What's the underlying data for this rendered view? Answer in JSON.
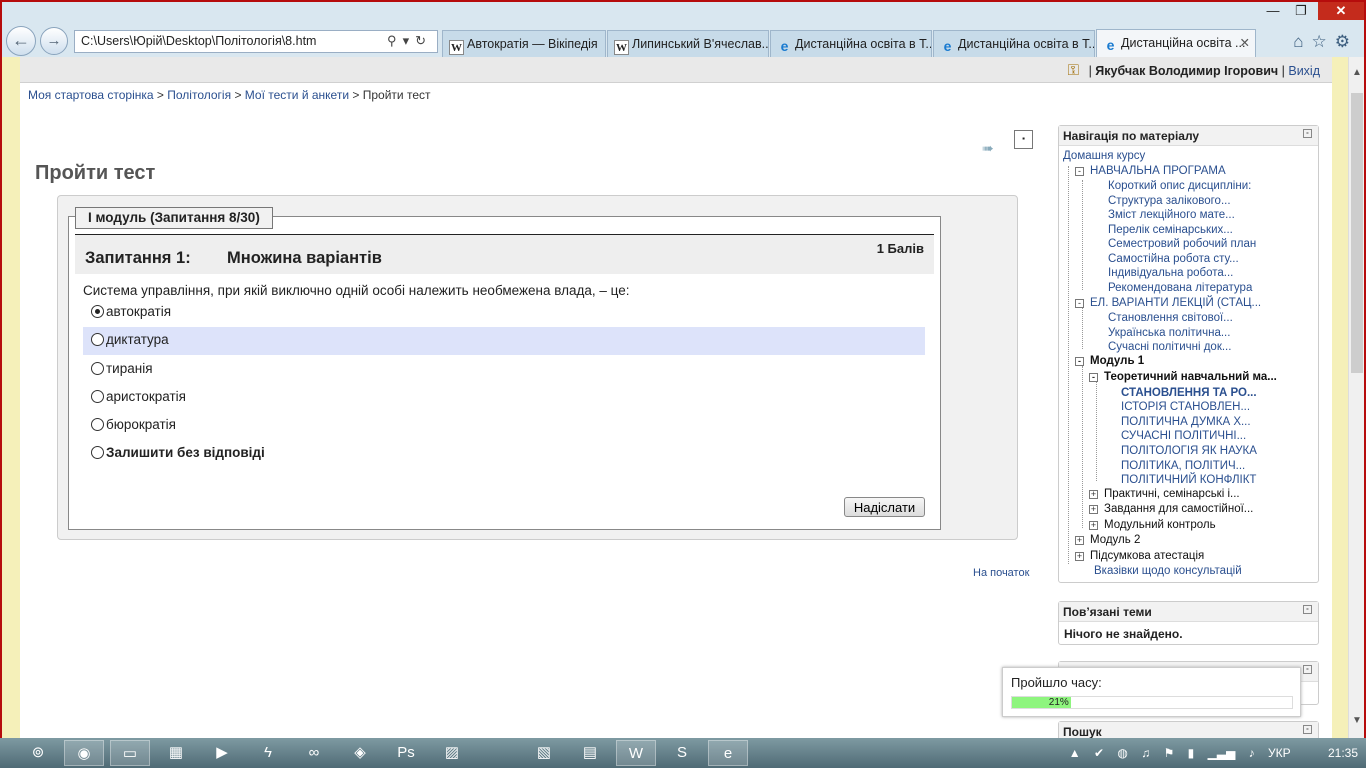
{
  "browser": {
    "address": "C:\\Users\\Юрій\\Desktop\\Політологія\\8.htm",
    "tabs": [
      {
        "label": "Автократія — Вікіпедія",
        "icon": "W"
      },
      {
        "label": "Липинський В'ячеслав...",
        "icon": "W"
      },
      {
        "label": "Дистанційна освіта в Т...",
        "icon": "e"
      },
      {
        "label": "Дистанційна освіта в Т...",
        "icon": "e"
      },
      {
        "label": "Дистанційна освіта ...",
        "icon": "e"
      }
    ],
    "window_buttons": {
      "minimize": "—",
      "maximize": "❐",
      "close": "✕"
    },
    "tab_close": "✕"
  },
  "header": {
    "user_name": "Якубчак Володимир Ігорович",
    "separator": "|",
    "logout": "Вихід"
  },
  "breadcrumb": {
    "items": [
      "Моя стартова сторінка",
      "Політологія",
      "Мої тести й анкети",
      "Пройти тест"
    ],
    "sep": ">"
  },
  "page": {
    "title": "Пройти тест",
    "to_top": "На початок"
  },
  "quiz": {
    "legend": "I модуль (Запитання 8/30)",
    "question_number": "Запитання 1:",
    "question_type": "Множина варіантів",
    "points": "1 Балів",
    "question_text": "Система управління, при якій виключно одній особі належить необмежена влада, – це:",
    "options": [
      {
        "label": "автократія",
        "selected": true
      },
      {
        "label": "диктатура",
        "selected": false
      },
      {
        "label": "тиранія",
        "selected": false
      },
      {
        "label": "аристократія",
        "selected": false
      },
      {
        "label": "бюрократія",
        "selected": false
      },
      {
        "label": "Залишити без відповіді",
        "selected": false
      }
    ],
    "submit_label": "Надіслати"
  },
  "navigation": {
    "title": "Навігація по матеріалу",
    "home": "Домашня курсу",
    "items": [
      {
        "label": "НАВЧАЛЬНА ПРОГРАМА",
        "toggle": "-"
      },
      {
        "label": "Короткий опис дисципліни:"
      },
      {
        "label": "Структура залікового..."
      },
      {
        "label": "Зміст лекційного мате..."
      },
      {
        "label": "Перелік семінарських..."
      },
      {
        "label": "Семестровий робочий план"
      },
      {
        "label": "Самостійна робота сту..."
      },
      {
        "label": "Індивідуальна робота..."
      },
      {
        "label": "Рекомендована література"
      },
      {
        "label": "ЕЛ. ВАРІАНТИ ЛЕКЦІЙ (СТАЦ...",
        "toggle": "-"
      },
      {
        "label": "Становлення світової..."
      },
      {
        "label": "Українська політична..."
      },
      {
        "label": "Сучасні політичні док..."
      },
      {
        "label": "Модуль 1",
        "toggle": "-"
      },
      {
        "label": "Теоретичний навчальний ма...",
        "toggle": "-"
      },
      {
        "label": "СТАНОВЛЕННЯ ТА РО..."
      },
      {
        "label": "ІСТОРІЯ СТАНОВЛЕН..."
      },
      {
        "label": "ПОЛІТИЧНА ДУМКА Х..."
      },
      {
        "label": "СУЧАСНІ ПОЛІТИЧНІ..."
      },
      {
        "label": "ПОЛІТОЛОГІЯ ЯК НАУКА"
      },
      {
        "label": "ПОЛІТИКА, ПОЛІТИЧ..."
      },
      {
        "label": "ПОЛІТИЧНИЙ КОНФЛІКТ"
      },
      {
        "label": "Практичні, семінарські і...",
        "toggle": "+"
      },
      {
        "label": "Завдання для самостійної...",
        "toggle": "+"
      },
      {
        "label": "Модульний контроль",
        "toggle": "+"
      },
      {
        "label": "Модуль 2",
        "toggle": "+"
      },
      {
        "label": "Підсумкова атестація",
        "toggle": "+"
      },
      {
        "label": "Вказівки щодо консультацій"
      }
    ]
  },
  "related": {
    "title": "Пов’язані теми",
    "empty": "Нічого не знайдено."
  },
  "timer": {
    "label": "Пройшло часу:",
    "percent_text": "21%",
    "progress_fraction": 0.21
  },
  "search_block": {
    "title": "Пошук"
  },
  "taskbar": {
    "language": "УКР",
    "time": "21:35"
  }
}
